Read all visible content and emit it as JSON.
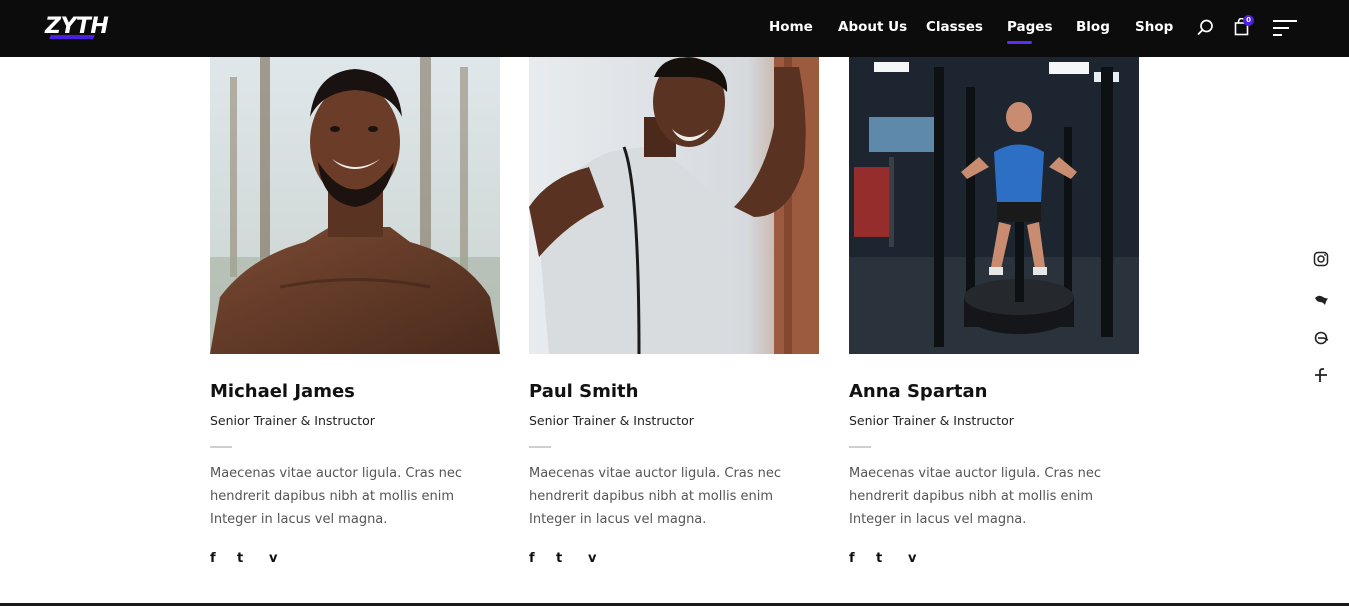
{
  "header": {
    "logo": "ZYTH",
    "nav": [
      {
        "label": "Home",
        "active": false
      },
      {
        "label": "About Us",
        "active": false
      },
      {
        "label": "Classes",
        "active": false
      },
      {
        "label": "Pages",
        "active": true
      },
      {
        "label": "Blog",
        "active": false
      },
      {
        "label": "Shop",
        "active": false
      }
    ],
    "cart_count": "0",
    "icons": [
      "search-icon",
      "cart-icon",
      "menu-icon"
    ]
  },
  "team": [
    {
      "name": "Michael James",
      "role": "Senior Trainer & Instructor",
      "description": "Maecenas vitae auctor ligula. Cras nec hendrerit dapibus nibh at mollis enim Integer in lacus vel magna.",
      "social": [
        "facebook-icon",
        "twitter-icon",
        "vimeo-icon"
      ]
    },
    {
      "name": "Paul Smith",
      "role": "Senior Trainer & Instructor",
      "description": "Maecenas vitae auctor ligula. Cras nec hendrerit dapibus nibh at mollis enim Integer in lacus vel magna.",
      "social": [
        "facebook-icon",
        "twitter-icon",
        "vimeo-icon"
      ]
    },
    {
      "name": "Anna Spartan",
      "role": "Senior Trainer & Instructor",
      "description": "Maecenas vitae auctor ligula. Cras nec hendrerit dapibus nibh at mollis enim Integer in lacus vel magna.",
      "social": [
        "facebook-icon",
        "twitter-icon",
        "vimeo-icon"
      ]
    }
  ],
  "side_social": [
    "instagram-icon",
    "bird-icon",
    "at-icon",
    "facebook-icon"
  ],
  "colors": {
    "header_bg": "#0c0c0c",
    "accent": "#4a1fe0",
    "text": "#111111",
    "body_text": "#555555"
  },
  "social_glyphs": {
    "facebook": "f",
    "twitter": "t",
    "vimeo": "v"
  }
}
